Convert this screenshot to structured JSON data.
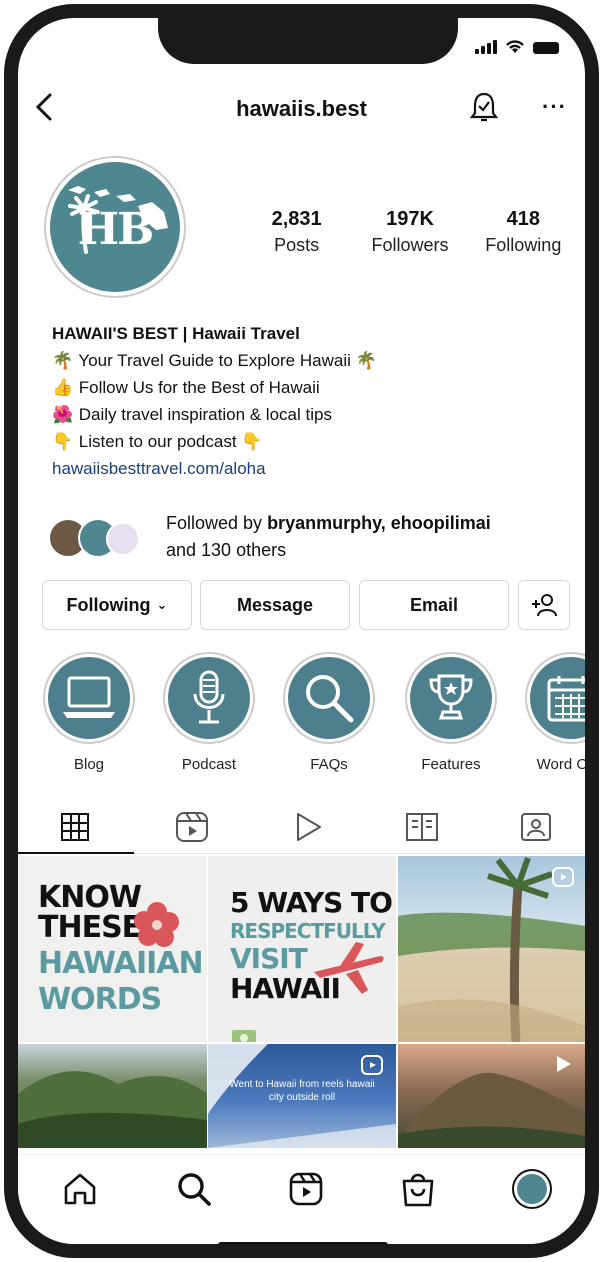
{
  "profile": {
    "username": "hawaiis.best",
    "avatar_text": "HB",
    "stats": [
      {
        "value": "2,831",
        "label": "Posts"
      },
      {
        "value": "197K",
        "label": "Followers"
      },
      {
        "value": "418",
        "label": "Following"
      }
    ],
    "bio": {
      "name": "HAWAII'S BEST | Hawaii Travel",
      "lines": [
        "Your Travel Guide to Explore Hawaii",
        "Follow Us for the Best of Hawaii",
        "Daily travel inspiration & local tips",
        "Listen to our podcast"
      ],
      "link": "hawaiisbesttravel.com/aloha"
    },
    "followed_by": {
      "prefix": "Followed by ",
      "names": "bryanmurphy, ehoopilimai",
      "suffix": "and 130 others"
    }
  },
  "actions": {
    "following": "Following",
    "message": "Message",
    "email": "Email"
  },
  "highlights": [
    {
      "label": "Blog",
      "icon": "laptop-icon"
    },
    {
      "label": "Podcast",
      "icon": "microphone-icon"
    },
    {
      "label": "FAQs",
      "icon": "magnifier-icon"
    },
    {
      "label": "Features",
      "icon": "trophy-icon"
    },
    {
      "label": "Word Of T",
      "icon": "calendar-icon"
    }
  ],
  "posts": {
    "p1": {
      "line1": "KNOW",
      "line2": "THESE",
      "line3": "HAWAIIAN",
      "line4": "WORDS"
    },
    "p2": {
      "line1": "5 WAYS TO",
      "line2": "RESPECTFULLY",
      "line3": "VISIT",
      "line4": "HAWAII"
    },
    "p5": {
      "caption": "Went to Hawaii from reels hawaii city outside roll"
    }
  },
  "colors": {
    "accent": "#4f8790",
    "link": "#1b3f7a",
    "teal_text": "#5a9aa0",
    "hibiscus": "#d9575a"
  }
}
